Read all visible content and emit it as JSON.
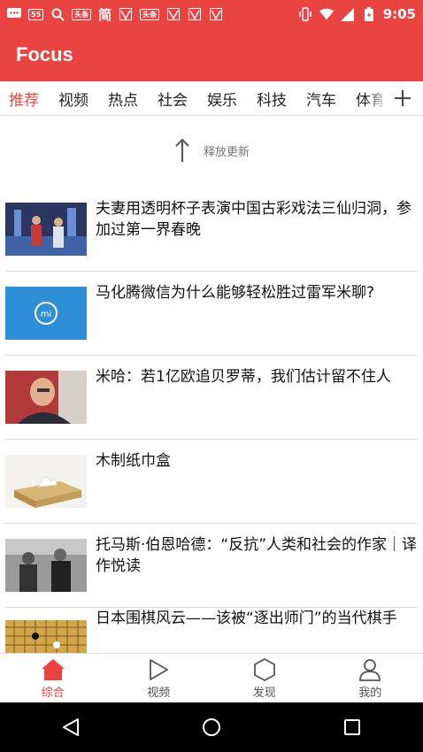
{
  "status_bar": {
    "time": "9:05",
    "badge_55": "55",
    "toutiao_label": "头条",
    "simplified_label": "简"
  },
  "app_bar": {
    "title": "Focus"
  },
  "tabs": [
    {
      "label": "推荐",
      "active": true
    },
    {
      "label": "视频"
    },
    {
      "label": "热点"
    },
    {
      "label": "社会"
    },
    {
      "label": "娱乐"
    },
    {
      "label": "科技"
    },
    {
      "label": "汽车"
    },
    {
      "label": "体育"
    }
  ],
  "refresh": {
    "text": "释放更新"
  },
  "feed": {
    "items": [
      {
        "title": "夫妻用透明杯子表演中国古彩戏法三仙归洞，参加过第一界春晚"
      },
      {
        "title": "马化腾微信为什么能够轻松胜过雷军米聊?"
      },
      {
        "title": "米哈：若1亿欧追贝罗蒂，我们估计留不住人"
      },
      {
        "title": "木制纸巾盒"
      },
      {
        "title": "托马斯·伯恩哈德：“反抗”人类和社会的作家｜译作悦读"
      },
      {
        "title": "日本围棋风云——该被“逐出师门”的当代棋手"
      }
    ],
    "miliao_logo_text": "mi"
  },
  "bottom_nav": [
    {
      "label": "综合",
      "icon": "home-icon",
      "active": true
    },
    {
      "label": "视频",
      "icon": "play-icon"
    },
    {
      "label": "发现",
      "icon": "hexagon-icon"
    },
    {
      "label": "我的",
      "icon": "person-icon"
    }
  ],
  "colors": {
    "brand": "#e94442",
    "divider": "#dcdcdc"
  }
}
